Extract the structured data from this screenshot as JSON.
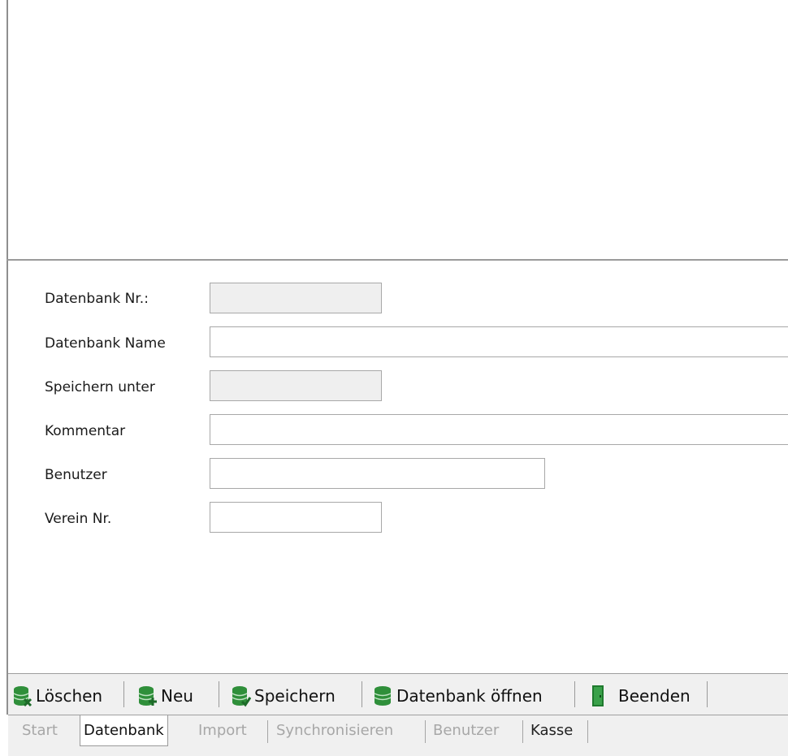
{
  "form": {
    "datenbank_nr_label": "Datenbank Nr.:",
    "datenbank_name_label": "Datenbank Name",
    "speichern_unter_label": "Speichern unter",
    "kommentar_label": "Kommentar",
    "benutzer_label": "Benutzer",
    "verein_nr_label": "Verein Nr.",
    "datenbank_nr_value": "",
    "datenbank_name_value": "",
    "speichern_unter_value": "",
    "kommentar_value": "",
    "benutzer_value": "",
    "verein_nr_value": ""
  },
  "toolbar": {
    "loeschen_label": "Löschen",
    "neu_label": "Neu",
    "speichern_label": "Speichern",
    "oeffnen_label": "Datenbank öffnen",
    "beenden_label": "Beenden"
  },
  "tabs": {
    "start": "Start",
    "datenbank": "Datenbank",
    "import": "Import",
    "sync": "Synchronisieren",
    "benutzer": "Benutzer",
    "kasse": "Kasse",
    "active": "Datenbank"
  },
  "icons": {
    "loeschen": "database-delete-icon",
    "neu": "database-add-icon",
    "speichern": "database-save-icon",
    "oeffnen": "database-icon",
    "beenden": "exit-door-icon"
  },
  "colors": {
    "icon_green": "#2f8f3a",
    "background": "#ffffff",
    "toolbar_bg": "#f0f0f0",
    "readonly_field": "#efefef",
    "disabled_text": "#a7a7a7"
  }
}
